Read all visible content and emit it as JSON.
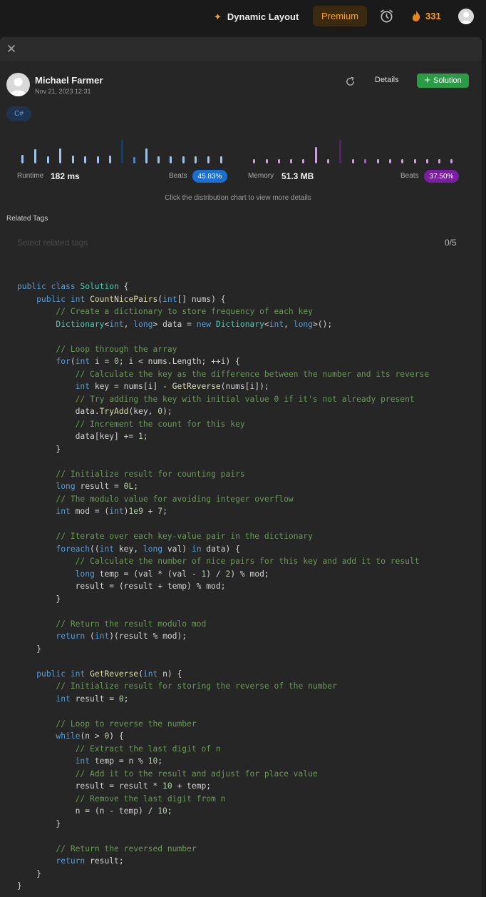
{
  "topbar": {
    "layout_label": "Dynamic Layout",
    "premium_label": "Premium",
    "streak_count": "331"
  },
  "submission": {
    "author": "Michael Farmer",
    "date": "Nov 21, 2023 12:31",
    "details_label": "Details",
    "solution_label": "Solution",
    "language": "C#"
  },
  "stats": {
    "runtime_label": "Runtime",
    "runtime_value": "182 ms",
    "runtime_beats_label": "Beats",
    "runtime_beats": "45.83%",
    "memory_label": "Memory",
    "memory_value": "51.3 MB",
    "memory_beats_label": "Beats",
    "memory_beats": "37.50%",
    "hint": "Click the distribution chart to view more details"
  },
  "tags": {
    "title": "Related Tags",
    "placeholder": "Select related tags",
    "count": "0/5"
  },
  "colors": {
    "accent_orange": "#ffa116",
    "solution_green": "#2c9b46",
    "runtime_blue": "#1a73e8",
    "memory_purple": "#7a1fa2"
  },
  "code": [
    [
      [
        "k",
        "public"
      ],
      [
        "v",
        " "
      ],
      [
        "k",
        "class"
      ],
      [
        "v",
        " "
      ],
      [
        "t",
        "Solution"
      ],
      [
        "v",
        " {"
      ]
    ],
    [
      [
        "v",
        "    "
      ],
      [
        "k",
        "public"
      ],
      [
        "v",
        " "
      ],
      [
        "k",
        "int"
      ],
      [
        "v",
        " "
      ],
      [
        "f",
        "CountNicePairs"
      ],
      [
        "v",
        "("
      ],
      [
        "k",
        "int"
      ],
      [
        "v",
        "[] nums) {"
      ]
    ],
    [
      [
        "v",
        "        "
      ],
      [
        "c",
        "// Create a dictionary to store frequency of each key"
      ]
    ],
    [
      [
        "v",
        "        "
      ],
      [
        "t",
        "Dictionary"
      ],
      [
        "v",
        "<"
      ],
      [
        "k",
        "int"
      ],
      [
        "v",
        ", "
      ],
      [
        "k",
        "long"
      ],
      [
        "v",
        "> data = "
      ],
      [
        "k",
        "new"
      ],
      [
        "v",
        " "
      ],
      [
        "t",
        "Dictionary"
      ],
      [
        "v",
        "<"
      ],
      [
        "k",
        "int"
      ],
      [
        "v",
        ", "
      ],
      [
        "k",
        "long"
      ],
      [
        "v",
        ">();"
      ]
    ],
    [
      [
        "v",
        ""
      ]
    ],
    [
      [
        "v",
        "        "
      ],
      [
        "c",
        "// Loop through the array"
      ]
    ],
    [
      [
        "v",
        "        "
      ],
      [
        "k",
        "for"
      ],
      [
        "v",
        "("
      ],
      [
        "k",
        "int"
      ],
      [
        "v",
        " i = "
      ],
      [
        "n",
        "0"
      ],
      [
        "v",
        "; i < nums.Length; ++i) {"
      ]
    ],
    [
      [
        "v",
        "            "
      ],
      [
        "c",
        "// Calculate the key as the difference between the number and its reverse"
      ]
    ],
    [
      [
        "v",
        "            "
      ],
      [
        "k",
        "int"
      ],
      [
        "v",
        " key = nums[i] - "
      ],
      [
        "f",
        "GetReverse"
      ],
      [
        "v",
        "(nums[i]);"
      ]
    ],
    [
      [
        "v",
        "            "
      ],
      [
        "c",
        "// Try adding the key with initial value 0 if it's not already present"
      ]
    ],
    [
      [
        "v",
        "            data."
      ],
      [
        "f",
        "TryAdd"
      ],
      [
        "v",
        "(key, "
      ],
      [
        "n",
        "0"
      ],
      [
        "v",
        ");"
      ]
    ],
    [
      [
        "v",
        "            "
      ],
      [
        "c",
        "// Increment the count for this key"
      ]
    ],
    [
      [
        "v",
        "            data[key] += "
      ],
      [
        "n",
        "1"
      ],
      [
        "v",
        ";"
      ]
    ],
    [
      [
        "v",
        "        }"
      ]
    ],
    [
      [
        "v",
        ""
      ]
    ],
    [
      [
        "v",
        "        "
      ],
      [
        "c",
        "// Initialize result for counting pairs"
      ]
    ],
    [
      [
        "v",
        "        "
      ],
      [
        "k",
        "long"
      ],
      [
        "v",
        " result = "
      ],
      [
        "n",
        "0L"
      ],
      [
        "v",
        ";"
      ]
    ],
    [
      [
        "v",
        "        "
      ],
      [
        "c",
        "// The modulo value for avoiding integer overflow"
      ]
    ],
    [
      [
        "v",
        "        "
      ],
      [
        "k",
        "int"
      ],
      [
        "v",
        " mod = ("
      ],
      [
        "k",
        "int"
      ],
      [
        "v",
        ")"
      ],
      [
        "n",
        "1e9"
      ],
      [
        "v",
        " + "
      ],
      [
        "n",
        "7"
      ],
      [
        "v",
        ";"
      ]
    ],
    [
      [
        "v",
        ""
      ]
    ],
    [
      [
        "v",
        "        "
      ],
      [
        "c",
        "// Iterate over each key-value pair in the dictionary"
      ]
    ],
    [
      [
        "v",
        "        "
      ],
      [
        "k",
        "foreach"
      ],
      [
        "v",
        "(("
      ],
      [
        "k",
        "int"
      ],
      [
        "v",
        " key, "
      ],
      [
        "k",
        "long"
      ],
      [
        "v",
        " val) "
      ],
      [
        "k",
        "in"
      ],
      [
        "v",
        " data) {"
      ]
    ],
    [
      [
        "v",
        "            "
      ],
      [
        "c",
        "// Calculate the number of nice pairs for this key and add it to result"
      ]
    ],
    [
      [
        "v",
        "            "
      ],
      [
        "k",
        "long"
      ],
      [
        "v",
        " temp = (val * (val - "
      ],
      [
        "n",
        "1"
      ],
      [
        "v",
        ") / "
      ],
      [
        "n",
        "2"
      ],
      [
        "v",
        ") % mod;"
      ]
    ],
    [
      [
        "v",
        "            result = (result + temp) % mod;"
      ]
    ],
    [
      [
        "v",
        "        }"
      ]
    ],
    [
      [
        "v",
        ""
      ]
    ],
    [
      [
        "v",
        "        "
      ],
      [
        "c",
        "// Return the result modulo mod"
      ]
    ],
    [
      [
        "v",
        "        "
      ],
      [
        "k",
        "return"
      ],
      [
        "v",
        " ("
      ],
      [
        "k",
        "int"
      ],
      [
        "v",
        ")(result % mod);"
      ]
    ],
    [
      [
        "v",
        "    }"
      ]
    ],
    [
      [
        "v",
        ""
      ]
    ],
    [
      [
        "v",
        "    "
      ],
      [
        "k",
        "public"
      ],
      [
        "v",
        " "
      ],
      [
        "k",
        "int"
      ],
      [
        "v",
        " "
      ],
      [
        "f",
        "GetReverse"
      ],
      [
        "v",
        "("
      ],
      [
        "k",
        "int"
      ],
      [
        "v",
        " n) {"
      ]
    ],
    [
      [
        "v",
        "        "
      ],
      [
        "c",
        "// Initialize result for storing the reverse of the number"
      ]
    ],
    [
      [
        "v",
        "        "
      ],
      [
        "k",
        "int"
      ],
      [
        "v",
        " result = "
      ],
      [
        "n",
        "0"
      ],
      [
        "v",
        ";"
      ]
    ],
    [
      [
        "v",
        ""
      ]
    ],
    [
      [
        "v",
        "        "
      ],
      [
        "c",
        "// Loop to reverse the number"
      ]
    ],
    [
      [
        "v",
        "        "
      ],
      [
        "k",
        "while"
      ],
      [
        "v",
        "(n > "
      ],
      [
        "n",
        "0"
      ],
      [
        "v",
        ") {"
      ]
    ],
    [
      [
        "v",
        "            "
      ],
      [
        "c",
        "// Extract the last digit of n"
      ]
    ],
    [
      [
        "v",
        "            "
      ],
      [
        "k",
        "int"
      ],
      [
        "v",
        " temp = n % "
      ],
      [
        "n",
        "10"
      ],
      [
        "v",
        ";"
      ]
    ],
    [
      [
        "v",
        "            "
      ],
      [
        "c",
        "// Add it to the result and adjust for place value"
      ]
    ],
    [
      [
        "v",
        "            result = result * "
      ],
      [
        "n",
        "10"
      ],
      [
        "v",
        " + temp;"
      ]
    ],
    [
      [
        "v",
        "            "
      ],
      [
        "c",
        "// Remove the last digit from n"
      ]
    ],
    [
      [
        "v",
        "            n = (n - temp) / "
      ],
      [
        "n",
        "10"
      ],
      [
        "v",
        ";"
      ]
    ],
    [
      [
        "v",
        "        }"
      ]
    ],
    [
      [
        "v",
        ""
      ]
    ],
    [
      [
        "v",
        "        "
      ],
      [
        "c",
        "// Return the reversed number"
      ]
    ],
    [
      [
        "v",
        "        "
      ],
      [
        "k",
        "return"
      ],
      [
        "v",
        " result;"
      ]
    ],
    [
      [
        "v",
        "    }"
      ]
    ],
    [
      [
        "v",
        "}"
      ]
    ]
  ]
}
